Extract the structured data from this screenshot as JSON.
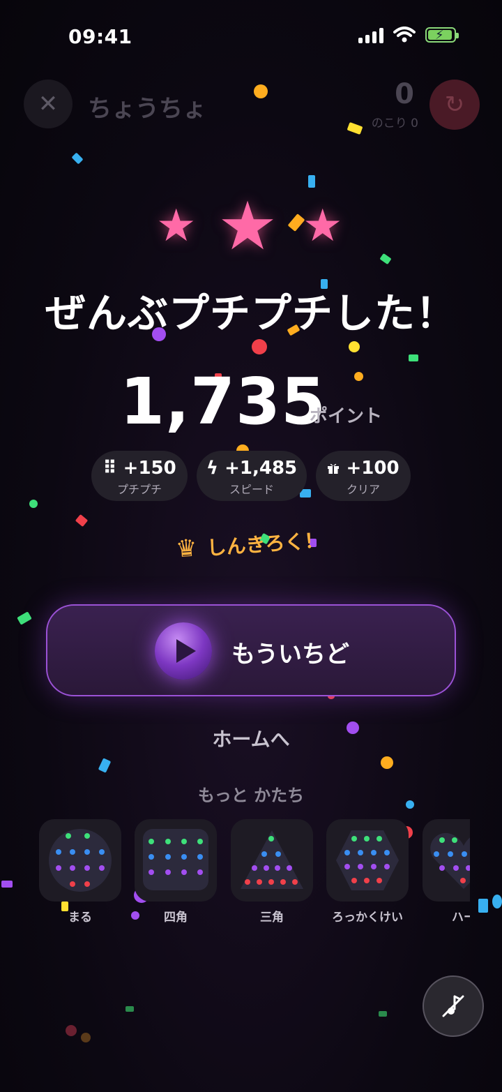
{
  "status": {
    "time": "09:41"
  },
  "top_bar": {
    "mode_title": "ちょうちょ",
    "remaining_count": "0",
    "remaining_label": "のこり 0"
  },
  "result": {
    "headline": "ぜんぶプチプチした！",
    "score": "1,735",
    "score_unit": "ポイント",
    "stars_earned": 3,
    "bonuses": [
      {
        "icon": "grid-icon",
        "value": "+150",
        "label": "プチプチ"
      },
      {
        "icon": "lightning-icon",
        "value": "+1,485",
        "label": "スピード"
      },
      {
        "icon": "gift-icon",
        "value": "+100",
        "label": "クリア"
      }
    ],
    "record_label": "しんきろく！"
  },
  "actions": {
    "retry_label": "もういちど",
    "home_label": "ホームへ"
  },
  "more": {
    "title": "もっと かたち",
    "shapes": [
      {
        "name": "まる"
      },
      {
        "name": "四角"
      },
      {
        "name": "三角"
      },
      {
        "name": "ろっかくけい"
      },
      {
        "name": "ハー"
      }
    ]
  },
  "colors": {
    "accent": "#9b52d6",
    "star": "#ff6aa7",
    "record": "#ffb341",
    "background": "#0c0812"
  }
}
